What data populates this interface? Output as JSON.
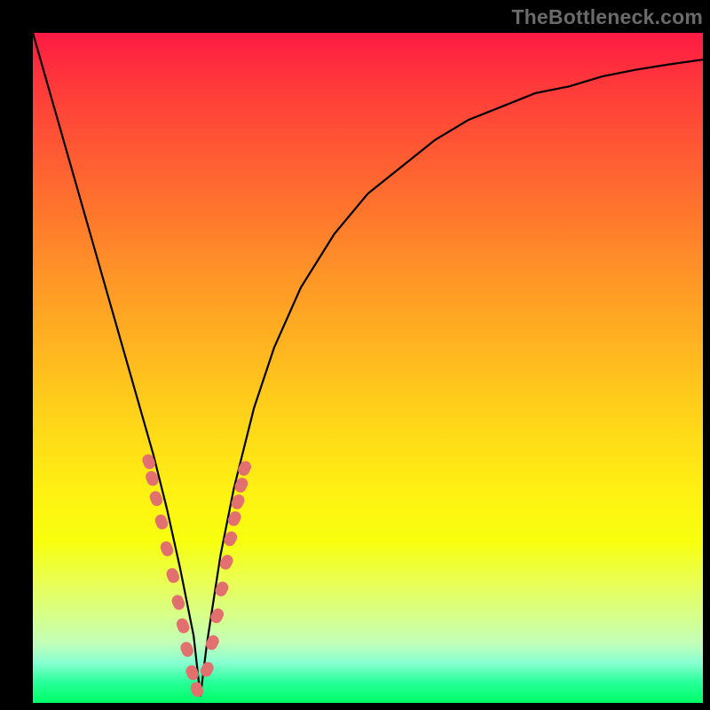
{
  "watermark": "TheBottleneck.com",
  "colors": {
    "frame": "#000000",
    "curve": "#000000",
    "bead": "#e2706e",
    "watermark": "#6a6a6a"
  },
  "chart_data": {
    "type": "line",
    "title": "",
    "xlabel": "",
    "ylabel": "",
    "xlim": [
      0,
      100
    ],
    "ylim": [
      0,
      100
    ],
    "grid": false,
    "legend": false,
    "series": [
      {
        "name": "curve",
        "x": [
          0,
          2,
          4,
          6,
          8,
          10,
          12,
          14,
          16,
          18,
          20,
          22,
          24,
          25,
          26,
          28,
          30,
          33,
          36,
          40,
          45,
          50,
          55,
          60,
          65,
          70,
          75,
          80,
          85,
          90,
          95,
          100
        ],
        "y": [
          100,
          93,
          86,
          79,
          72,
          65,
          58,
          51,
          44,
          37,
          29,
          20,
          10,
          1,
          9,
          22,
          32,
          44,
          53,
          62,
          70,
          76,
          80,
          84,
          87,
          89,
          91,
          92,
          93.5,
          94.5,
          95.3,
          96
        ]
      }
    ],
    "markers": {
      "name": "beads-overlay",
      "note": "salmon lozenge markers highlighted near the minimum on both arms",
      "x": [
        17.3,
        17.8,
        18.4,
        19.2,
        20.0,
        20.9,
        21.7,
        22.4,
        23.0,
        23.8,
        24.5,
        26.0,
        26.8,
        27.5,
        28.2,
        28.9,
        29.5,
        30.1,
        30.6,
        31.1,
        31.6
      ],
      "y": [
        36.0,
        33.5,
        30.5,
        27.0,
        23.0,
        19.0,
        15.0,
        11.5,
        8.0,
        4.5,
        2.0,
        5.0,
        9.0,
        13.0,
        17.0,
        21.0,
        24.5,
        27.5,
        30.0,
        32.5,
        35.0
      ]
    },
    "minimum": {
      "x": 25,
      "y": 1
    }
  }
}
